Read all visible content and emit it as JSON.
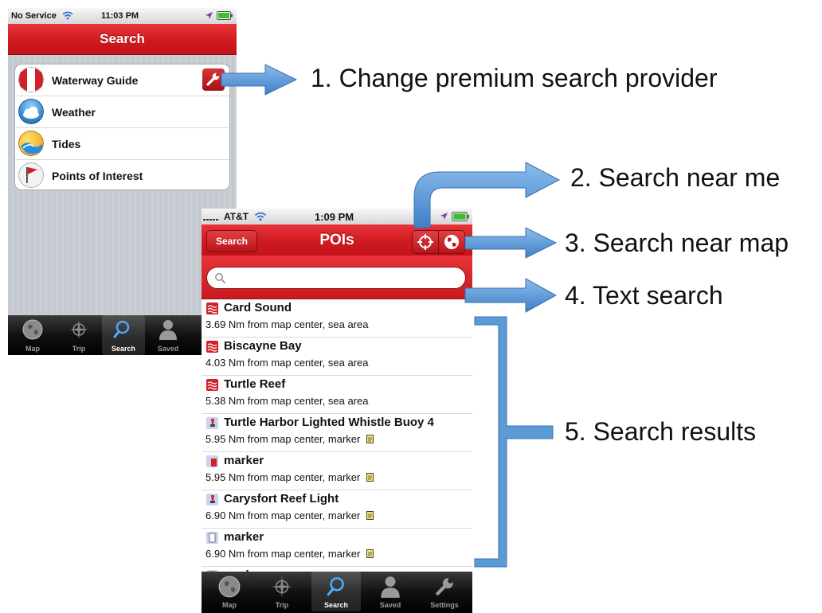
{
  "phone1": {
    "status": {
      "carrier": "No Service",
      "time": "11:03 PM"
    },
    "nav_title": "Search",
    "items": [
      {
        "label": "Waterway Guide",
        "icon": "waterway-guide-icon"
      },
      {
        "label": "Weather",
        "icon": "weather-icon"
      },
      {
        "label": "Tides",
        "icon": "tides-icon"
      },
      {
        "label": "Points of Interest",
        "icon": "poi-flag-icon"
      }
    ],
    "tabs": [
      {
        "label": "Map",
        "icon": "globe-icon"
      },
      {
        "label": "Trip",
        "icon": "compass-icon"
      },
      {
        "label": "Search",
        "icon": "magnifier-icon",
        "selected": true
      },
      {
        "label": "Saved",
        "icon": "person-icon"
      }
    ]
  },
  "phone2": {
    "status": {
      "carrier": "AT&T",
      "time": "1:09 PM"
    },
    "back_label": "Search",
    "nav_title": "POIs",
    "search": {
      "placeholder": ""
    },
    "results": [
      {
        "title": "Card Sound",
        "subtitle": "3.69 Nm from map center, sea area",
        "icon": "sea-area-icon",
        "note": false
      },
      {
        "title": "Biscayne Bay",
        "subtitle": "4.03 Nm from map center, sea area",
        "icon": "sea-area-icon",
        "note": false
      },
      {
        "title": "Turtle Reef",
        "subtitle": "5.38 Nm from map center, sea area",
        "icon": "sea-area-icon",
        "note": false
      },
      {
        "title": "Turtle Harbor Lighted Whistle Buoy 4",
        "subtitle": "5.95 Nm from map center, marker",
        "icon": "buoy-icon",
        "note": true
      },
      {
        "title": "marker",
        "subtitle": "5.95 Nm from map center, marker",
        "icon": "red-marker-icon",
        "note": true
      },
      {
        "title": "Carysfort Reef Light",
        "subtitle": "6.90 Nm from map center, marker",
        "icon": "buoy-icon",
        "note": true
      },
      {
        "title": "marker",
        "subtitle": "6.90 Nm from map center, marker",
        "icon": "white-marker-icon",
        "note": true
      },
      {
        "title": "marker",
        "subtitle": "",
        "icon": "white-marker-icon",
        "note": false
      }
    ],
    "tabs": [
      {
        "label": "Map",
        "icon": "globe-icon"
      },
      {
        "label": "Trip",
        "icon": "compass-icon"
      },
      {
        "label": "Search",
        "icon": "magnifier-icon",
        "selected": true
      },
      {
        "label": "Saved",
        "icon": "person-icon"
      },
      {
        "label": "Settings",
        "icon": "wrench-icon"
      }
    ]
  },
  "annotations": [
    "1. Change premium search provider",
    "2. Search near me",
    "3. Search near map",
    "4. Text search",
    "5. Search results"
  ],
  "colors": {
    "brand_red": "#d22026",
    "arrow_blue": "#5b9bd5"
  }
}
